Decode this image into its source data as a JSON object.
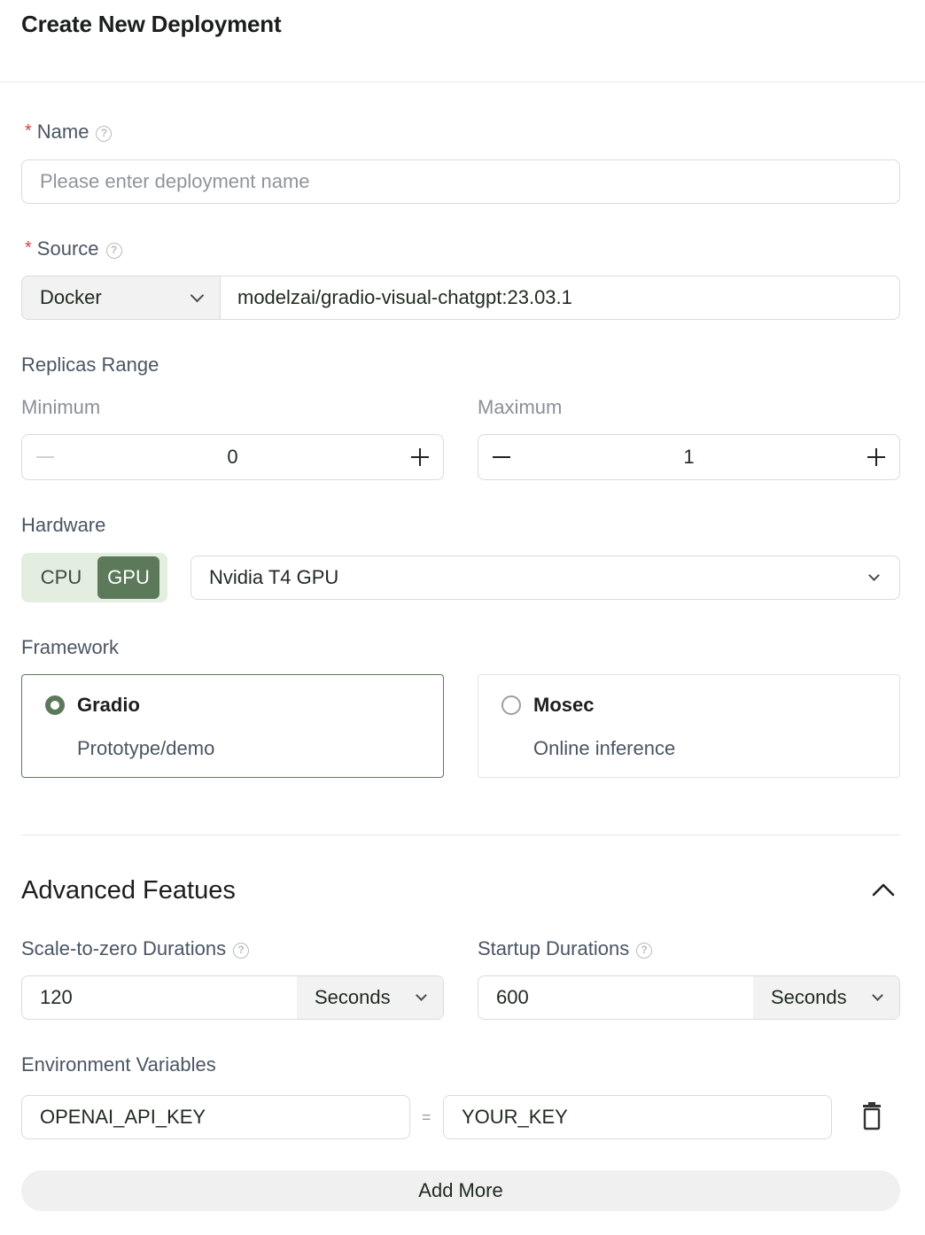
{
  "header": {
    "title": "Create New Deployment"
  },
  "name_field": {
    "label": "Name",
    "placeholder": "Please enter deployment name",
    "required": true
  },
  "source_field": {
    "label": "Source",
    "required": true,
    "type": "Docker",
    "image": "modelzai/gradio-visual-chatgpt:23.03.1"
  },
  "replicas": {
    "label": "Replicas Range",
    "min_label": "Minimum",
    "min_value": "0",
    "max_label": "Maximum",
    "max_value": "1"
  },
  "hardware": {
    "label": "Hardware",
    "options": [
      "CPU",
      "GPU"
    ],
    "selected": "GPU",
    "gpu_model": "Nvidia T4 GPU"
  },
  "framework": {
    "label": "Framework",
    "options": [
      {
        "title": "Gradio",
        "description": "Prototype/demo",
        "selected": true
      },
      {
        "title": "Mosec",
        "description": "Online inference",
        "selected": false
      }
    ]
  },
  "advanced": {
    "title": "Advanced Featues",
    "scale_to_zero": {
      "label": "Scale-to-zero Durations",
      "value": "120",
      "unit": "Seconds"
    },
    "startup": {
      "label": "Startup Durations",
      "value": "600",
      "unit": "Seconds"
    },
    "env": {
      "label": "Environment Variables",
      "key": "OPENAI_API_KEY",
      "equals": "=",
      "value": "YOUR_KEY"
    },
    "add_more": "Add More"
  },
  "colors": {
    "accent": "#5c7a5a",
    "toggle_bg": "#e4eee0",
    "required": "#d14343"
  }
}
